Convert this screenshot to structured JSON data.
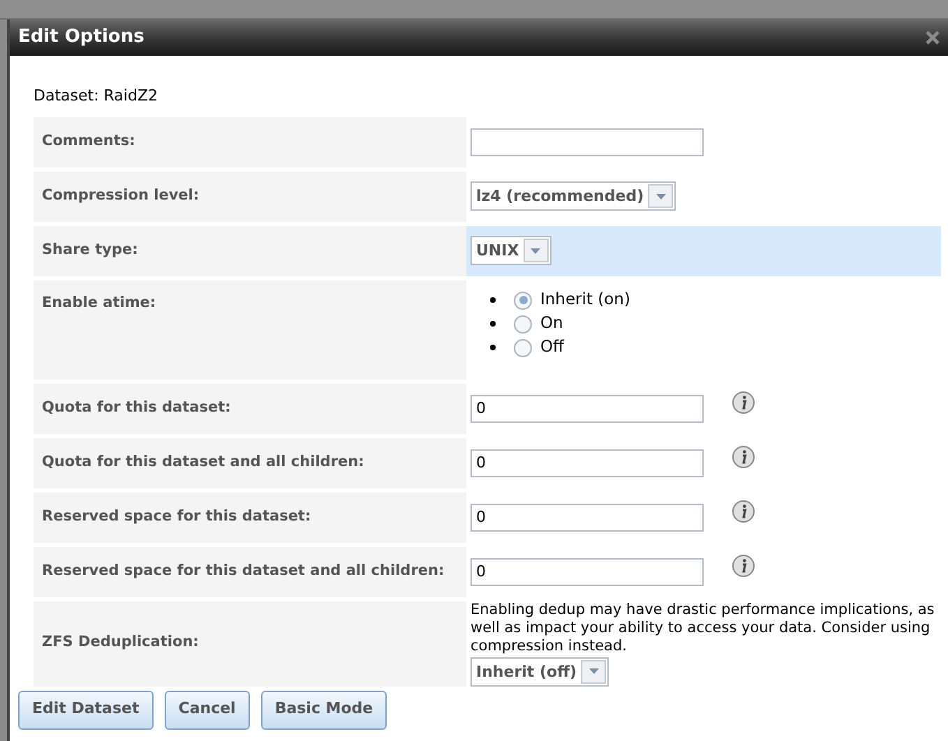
{
  "dialog": {
    "title": "Edit Options",
    "dataset": "Dataset: RaidZ2"
  },
  "rows": [
    {
      "kind": "text",
      "label": "Comments:",
      "value": "",
      "info": false,
      "highlighted": false
    },
    {
      "kind": "select",
      "label": "Compression level:",
      "value": "lz4 (recommended)",
      "highlighted": false
    },
    {
      "kind": "select",
      "label": "Share type:",
      "value": "UNIX",
      "highlighted": true
    },
    {
      "kind": "radio",
      "label": "Enable atime:",
      "highlighted": false,
      "options": [
        {
          "label": "Inherit (on)",
          "selected": true
        },
        {
          "label": "On",
          "selected": false
        },
        {
          "label": "Off",
          "selected": false
        }
      ]
    },
    {
      "kind": "text",
      "label": "Quota for this dataset:",
      "value": "0",
      "info": true,
      "highlighted": false
    },
    {
      "kind": "text",
      "label": "Quota for this dataset and all children:",
      "value": "0",
      "info": true,
      "highlighted": false
    },
    {
      "kind": "text",
      "label": "Reserved space for this dataset:",
      "value": "0",
      "info": true,
      "highlighted": false
    },
    {
      "kind": "text",
      "label": "Reserved space for this dataset and all children:",
      "value": "0",
      "info": true,
      "highlighted": false
    },
    {
      "kind": "select",
      "label": "ZFS Deduplication:",
      "note": "Enabling dedup may have drastic performance implications, as well as impact your ability to access your data. Consider using compression instead.",
      "value": "Inherit (off)",
      "highlighted": false
    }
  ],
  "buttons": [
    "Edit Dataset",
    "Cancel",
    "Basic Mode"
  ]
}
